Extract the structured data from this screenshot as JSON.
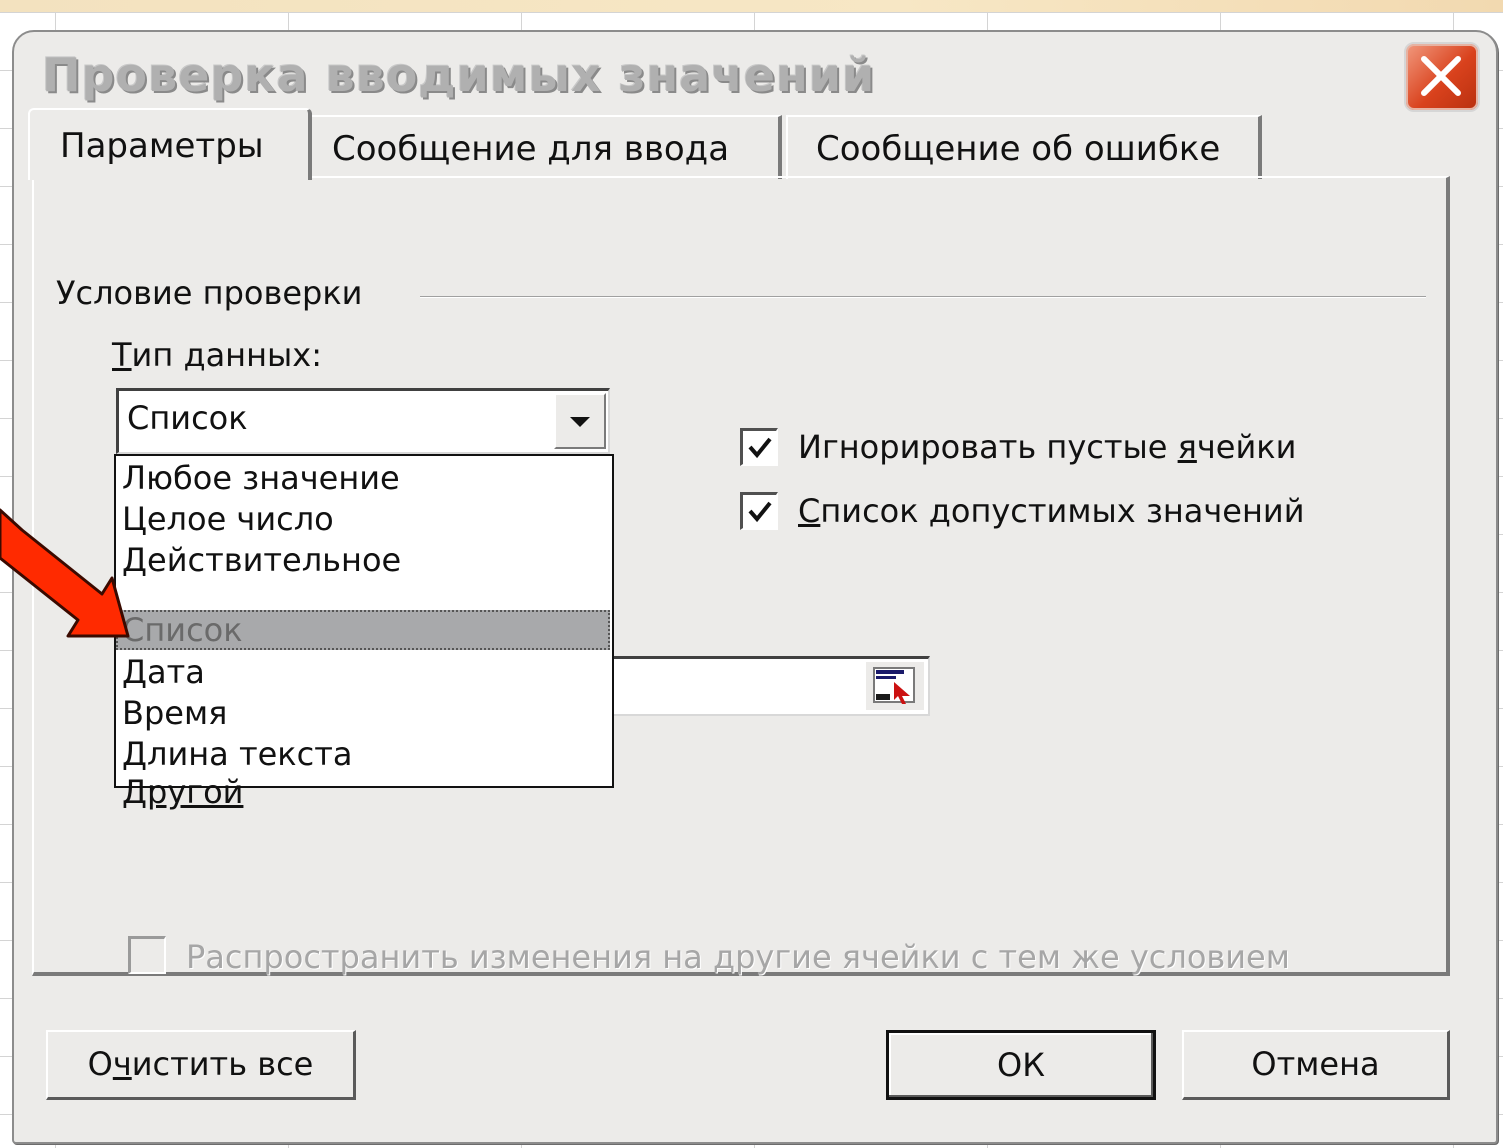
{
  "dialog": {
    "title": "Проверка вводимых значений",
    "tabs": [
      {
        "label": "Параметры",
        "active": true
      },
      {
        "label": "Сообщение для ввода",
        "active": false
      },
      {
        "label": "Сообщение об ошибке",
        "active": false
      }
    ]
  },
  "settings": {
    "group_label": "Условие проверки",
    "data_type_label_mnemonic": "Т",
    "data_type_label_rest": "ип данных:",
    "data_type_value": "Список",
    "data_type_options": [
      "Любое значение",
      "Целое число",
      "Действительное",
      "Список",
      "Дата",
      "Время",
      "Длина текста",
      "Другой"
    ],
    "selected_option_index": 3,
    "ignore_blank": {
      "checked": true,
      "label_before": "Игнорировать пустые ",
      "label_mnemonic": "я",
      "label_after": "чейки"
    },
    "in_cell_dropdown": {
      "checked": true,
      "label_mnemonic": "С",
      "label_after": "писок допустимых значений"
    },
    "apply_to_all": {
      "checked": false,
      "enabled": false,
      "label": "Распространить изменения на другие ячейки с тем же условием"
    }
  },
  "buttons": {
    "clear_before": "О",
    "clear_mnemonic": "ч",
    "clear_after": "истить все",
    "ok": "ОК",
    "cancel": "Отмена"
  },
  "colors": {
    "dialog_bg": "#ecebe9",
    "annotation_arrow": "#ff2a00",
    "close_button": "#d9421d",
    "selection": "#a8a9ab"
  },
  "icons": {
    "close": "close-icon",
    "dropdown": "chevron-down-icon",
    "collapse": "collapse-dialog-icon",
    "check": "checkmark-icon"
  }
}
